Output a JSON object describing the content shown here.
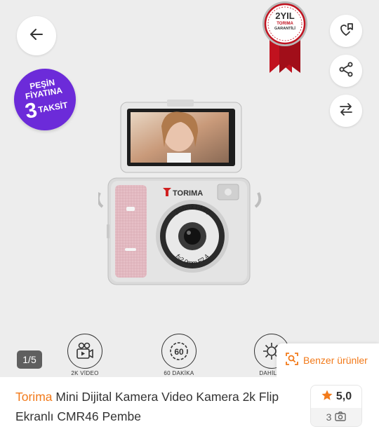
{
  "gallery": {
    "promo": {
      "line1": "PEŞİN",
      "line2": "FİYATINA",
      "number": "3",
      "line3": "TAKSİT"
    },
    "warranty": {
      "years": "2YIL",
      "brand": "TORIMA",
      "label": "GARANTİLİ"
    },
    "camera": {
      "brand": "TORIMA",
      "lens_text_top": "2560x1440",
      "lens_text_bottom": "f=2.0mm F2.4"
    },
    "features": [
      {
        "label": "2K VİDEO",
        "icon": "video-camera-icon"
      },
      {
        "label": "60 DAKİKA",
        "icon": "timer-60-icon"
      },
      {
        "label": "DAHİLİ F",
        "icon": "flash-icon"
      }
    ],
    "counter": "1/5",
    "similar_label": "Benzer ürünler"
  },
  "actions": {
    "back": "back-arrow-icon",
    "favorite": "heart-add-icon",
    "share": "share-icon",
    "compare": "compare-arrows-icon"
  },
  "product": {
    "brand": "Torima",
    "title": "Mini Dijital Kamera Video Kamera 2k Flip Ekranlı CMR46 Pembe",
    "rating": "5,0",
    "photo_count": "3"
  },
  "colors": {
    "accent": "#f27a1a",
    "promo": "#6c2bd9",
    "warranty_red": "#c1121f",
    "star": "#f27a1a"
  }
}
